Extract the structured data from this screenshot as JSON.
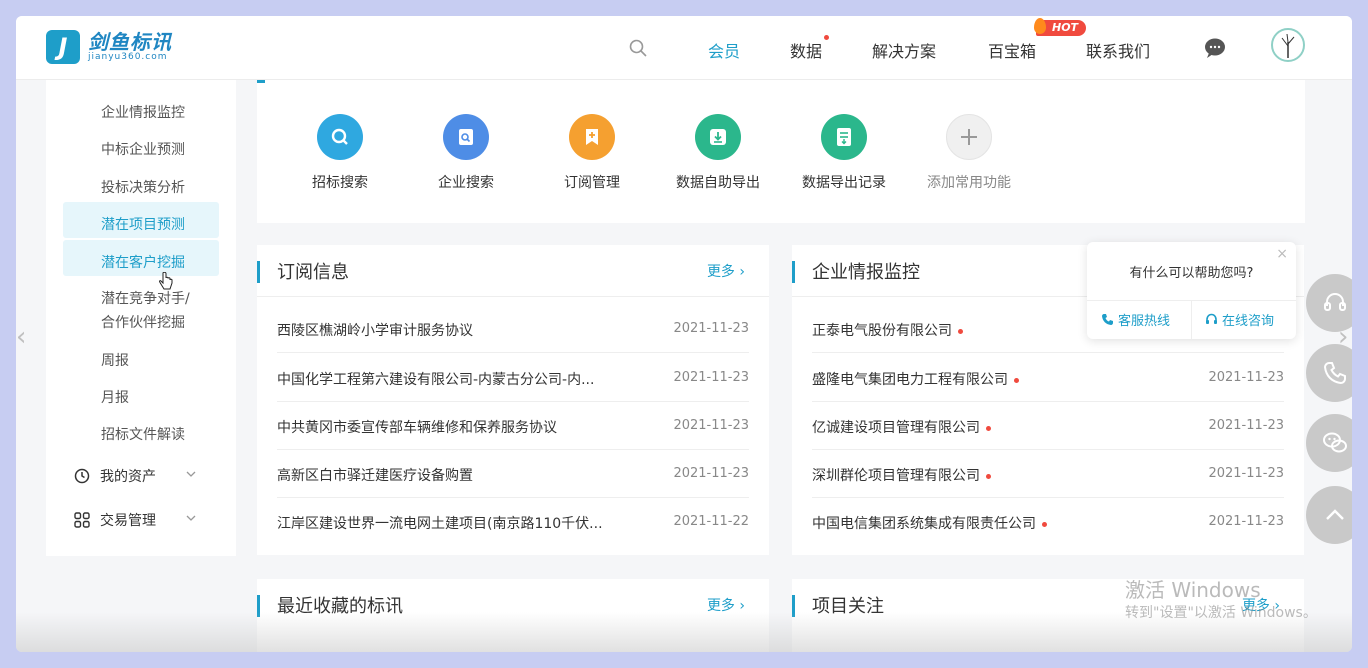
{
  "brand": {
    "name": "剑鱼标讯",
    "domain": "jianyu360.com",
    "mark": "J"
  },
  "nav": {
    "items": [
      {
        "label": "会员",
        "active": true
      },
      {
        "label": "数据",
        "has_dot": true
      },
      {
        "label": "解决方案"
      },
      {
        "label": "百宝箱",
        "badge": "HOT"
      },
      {
        "label": "联系我们"
      }
    ]
  },
  "sidebar": {
    "items": [
      {
        "label": "企业情报监控"
      },
      {
        "label": "中标企业预测"
      },
      {
        "label": "投标决策分析"
      },
      {
        "label": "潜在项目预测",
        "highlighted": true
      },
      {
        "label": "潜在客户挖掘",
        "highlighted": true
      },
      {
        "label": "潜在竞争对手/"
      },
      {
        "label": "合作伙伴挖掘"
      },
      {
        "label": "周报"
      },
      {
        "label": "月报"
      },
      {
        "label": "招标文件解读"
      }
    ],
    "groups": [
      {
        "label": "我的资产",
        "icon": "clock-icon"
      },
      {
        "label": "交易管理",
        "icon": "grid-icon"
      }
    ]
  },
  "quick_functions": [
    {
      "label": "招标搜索",
      "icon": "search-icon",
      "color": "#2fa8e0"
    },
    {
      "label": "企业搜索",
      "icon": "company-search-icon",
      "color": "#4e8de6"
    },
    {
      "label": "订阅管理",
      "icon": "subscribe-icon",
      "color": "#f5a030"
    },
    {
      "label": "数据自助导出",
      "icon": "export-icon",
      "color": "#2bb78c"
    },
    {
      "label": "数据导出记录",
      "icon": "export-record-icon",
      "color": "#2bb78c"
    },
    {
      "label": "添加常用功能",
      "icon": "plus-icon",
      "color": "#eeeeee"
    }
  ],
  "subscription": {
    "title": "订阅信息",
    "more": "更多",
    "rows": [
      {
        "text": "西陵区樵湖岭小学审计服务协议",
        "date": "2021-11-23"
      },
      {
        "text": "中国化学工程第六建设有限公司-内蒙古分公司-内...",
        "date": "2021-11-23"
      },
      {
        "text": "中共黄冈市委宣传部车辆维修和保养服务协议",
        "date": "2021-11-23"
      },
      {
        "text": "高新区白市驿迁建医疗设备购置",
        "date": "2021-11-23"
      },
      {
        "text": "江岸区建设世界一流电网土建项目(南京路110千伏...",
        "date": "2021-11-22"
      }
    ]
  },
  "enterprise": {
    "title": "企业情报监控",
    "rows": [
      {
        "text": "正泰电气股份有限公司",
        "date": ""
      },
      {
        "text": "盛隆电气集团电力工程有限公司",
        "date": "2021-11-23"
      },
      {
        "text": "亿诚建设项目管理有限公司",
        "date": "2021-11-23"
      },
      {
        "text": "深圳群伦项目管理有限公司",
        "date": "2021-11-23"
      },
      {
        "text": "中国电信集团系统集成有限责任公司",
        "date": "2021-11-23"
      }
    ]
  },
  "favorites": {
    "title": "最近收藏的标讯",
    "more": "更多"
  },
  "projects": {
    "title": "项目关注",
    "more": "更多"
  },
  "help": {
    "question": "有什么可以帮助您吗?",
    "close": "×",
    "hotline": "客服热线",
    "online": "在线咨询"
  },
  "watermark": {
    "line1": "激活 Windows",
    "line2": "转到\"设置\"以激活 Windows。"
  },
  "colors": {
    "accent": "#1e9ec9",
    "alert": "#f04a3e"
  }
}
